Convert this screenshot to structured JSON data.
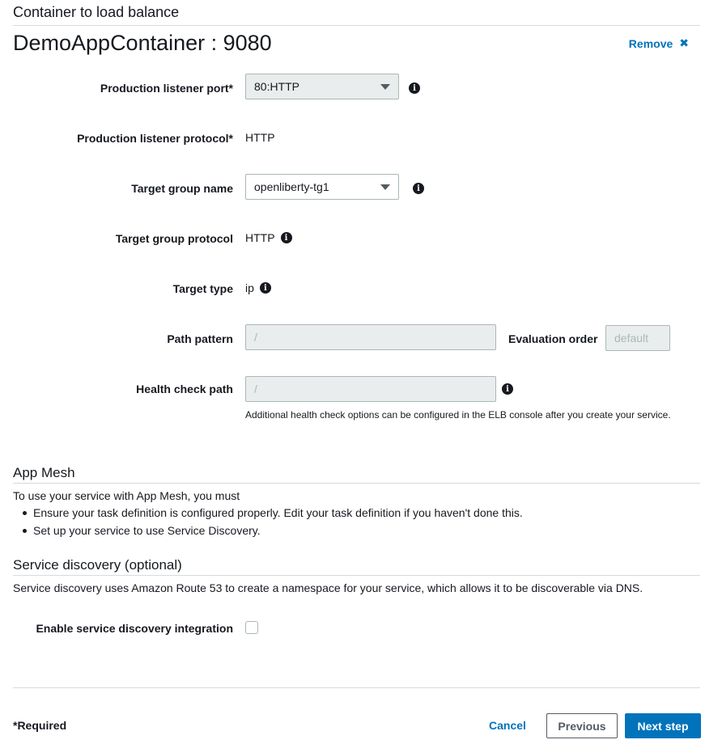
{
  "section": {
    "title": "Container to load balance"
  },
  "container": {
    "name": "DemoAppContainer : 9080",
    "remove_label": "Remove",
    "remove_icon": "close-icon"
  },
  "fields": {
    "production_listener_port": {
      "label": "Production listener port*",
      "value": "80:HTTP"
    },
    "production_listener_protocol": {
      "label": "Production listener protocol*",
      "value": "HTTP"
    },
    "target_group_name": {
      "label": "Target group name",
      "value": "openliberty-tg1"
    },
    "target_group_protocol": {
      "label": "Target group protocol",
      "value": "HTTP"
    },
    "target_type": {
      "label": "Target type",
      "value": "ip"
    },
    "path_pattern": {
      "label": "Path pattern",
      "placeholder": "/"
    },
    "evaluation_order": {
      "label": "Evaluation order",
      "placeholder": "default"
    },
    "health_check_path": {
      "label": "Health check path",
      "placeholder": "/",
      "helper": "Additional health check options can be configured in the ELB console after you create your service."
    }
  },
  "app_mesh": {
    "title": "App Mesh",
    "intro": "To use your service with App Mesh, you must",
    "bullets": [
      "Ensure your task definition is configured properly. Edit your task definition if you haven't done this.",
      "Set up your service to use Service Discovery."
    ]
  },
  "service_discovery": {
    "title": "Service discovery (optional)",
    "description": "Service discovery uses Amazon Route 53 to create a namespace for your service, which allows it to be discoverable via DNS.",
    "enable_label": "Enable service discovery integration",
    "enabled": false
  },
  "footer": {
    "required_note": "*Required",
    "cancel_label": "Cancel",
    "previous_label": "Previous",
    "next_label": "Next step"
  },
  "colors": {
    "link": "#0073bb",
    "primary_button": "#0073bb",
    "text": "#16191f",
    "disabled_field": "#eaeded"
  }
}
